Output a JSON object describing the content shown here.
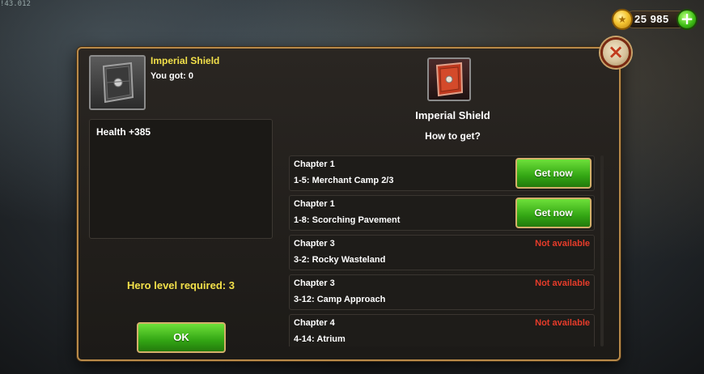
{
  "debug_text": "!43.012",
  "currency": {
    "amount": "25 985",
    "coin_icon": "gold-coin-icon",
    "plus_label": "+"
  },
  "dialog": {
    "close_label": "×",
    "item": {
      "name": "Imperial Shield",
      "you_got": "You got:  0",
      "stat": "Health +385",
      "icon": "shield-icon"
    },
    "hero_level": "Hero level required:  3",
    "ok_label": "OK",
    "right": {
      "title": "Imperial Shield",
      "how_to": "How to get?",
      "sources": [
        {
          "chapter": "Chapter 1",
          "stage": "1-5: Merchant Camp  2/3",
          "action": "Get now",
          "available": true
        },
        {
          "chapter": "Chapter 1",
          "stage": "1-8: Scorching Pavement",
          "action": "Get now",
          "available": true
        },
        {
          "chapter": "Chapter 3",
          "stage": "3-2: Rocky Wasteland",
          "action": "Not available",
          "available": false
        },
        {
          "chapter": "Chapter 3",
          "stage": "3-12: Camp Approach",
          "action": "Not available",
          "available": false
        },
        {
          "chapter": "Chapter 4",
          "stage": "4-14: Atrium",
          "action": "Not available",
          "available": false
        }
      ]
    }
  },
  "colors": {
    "accent_yellow": "#f2e04a",
    "button_green": "#33a614",
    "unavailable_red": "#e63b2a",
    "frame_gold": "#b98a49"
  }
}
